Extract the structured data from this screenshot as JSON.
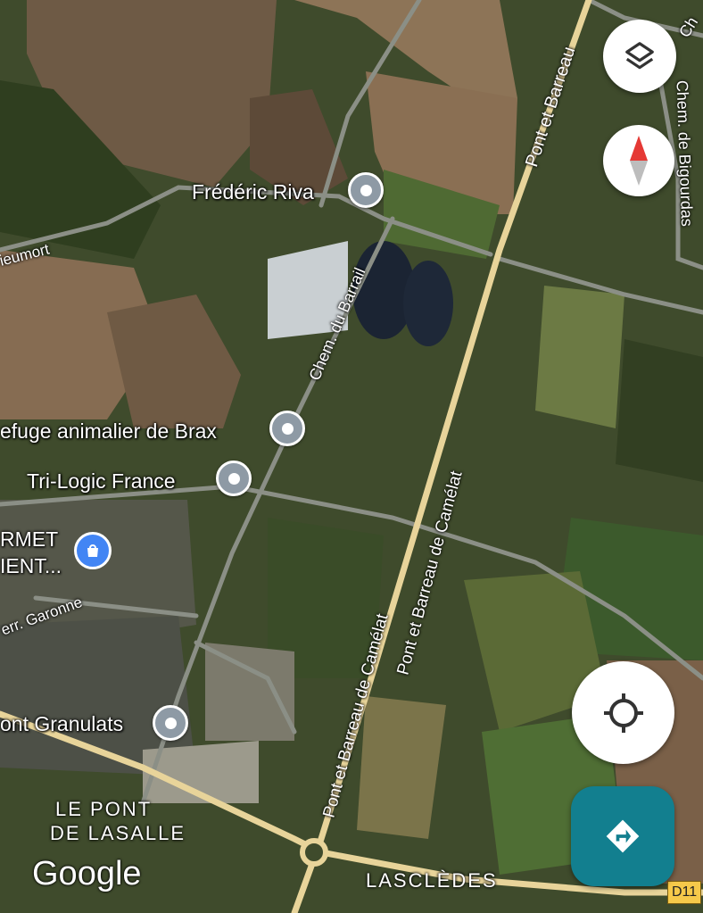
{
  "map": {
    "pois": [
      {
        "name": "Frédéric Riva"
      },
      {
        "name": "efuge animalier de Brax"
      },
      {
        "name": "Tri-Logic France"
      },
      {
        "name": "RMET"
      },
      {
        "name": "IENT..."
      },
      {
        "name": "ont Granulats"
      }
    ],
    "roads": {
      "r1": "Pont et Barreau",
      "r2": "Pont et Barreau de Camélat",
      "r3": "Pont et Barreau de Camélat",
      "r4": "Chem. du Barrail",
      "r5": "Chem. de Bigourdas",
      "r6": "ieumort",
      "r7": "err. Garonne",
      "r8": "Ch"
    },
    "places": {
      "p1_line1": "LE PONT",
      "p1_line2": "DE LASALLE",
      "p2": "LASCLÈDES"
    },
    "shield": "D11",
    "attribution": "Google",
    "icons": {
      "layers": "layers-icon",
      "compass": "compass-icon",
      "locate": "my-location-icon",
      "directions": "directions-icon",
      "shopping": "shopping-bag-icon"
    },
    "colors": {
      "major_road": "#e8d49a",
      "minor_road": "#8b8f86",
      "directions_fab": "#127f8f",
      "poi_pin": "#8e9aa5",
      "shop_pin": "#4285f4"
    }
  }
}
